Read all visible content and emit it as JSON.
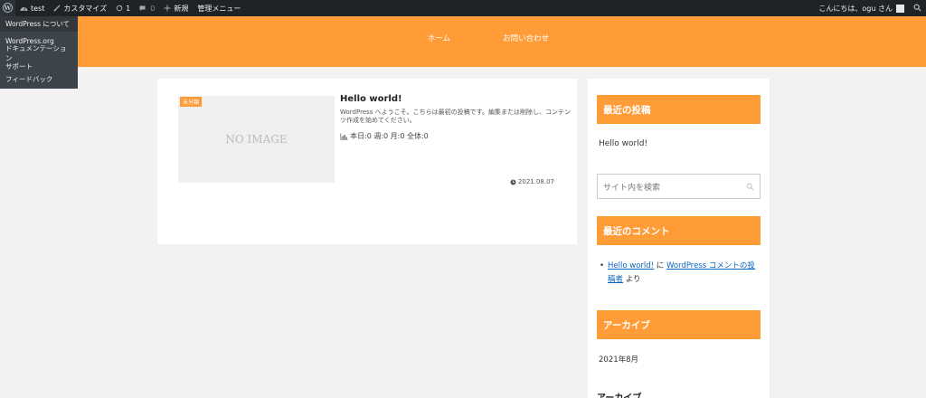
{
  "adminbar": {
    "site_name": "test",
    "customize": "カスタマイズ",
    "updates_count": "1",
    "comments_count": "0",
    "new_label": "新規",
    "menu_label": "管理メニュー",
    "greeting": "こんにちは、ogu さん"
  },
  "wp_menu": {
    "about": "WordPress について",
    "items": [
      "WordPress.org",
      "ドキュメンテーション",
      "サポート",
      "フィードバック"
    ]
  },
  "nav": {
    "items": [
      "ホーム",
      "お問い合わせ"
    ]
  },
  "post": {
    "category": "未分類",
    "thumbnail_text": "NO IMAGE",
    "title": "Hello world!",
    "excerpt": "WordPress へようこそ。こちらは最初の投稿です。編集または削除し、コンテンツ作成を始めてください。",
    "stats": "本日:0 週:0 月:0 全体:0",
    "date": "2021.08.07"
  },
  "sidebar": {
    "recent_posts_title": "最近の投稿",
    "recent_post": "Hello world!",
    "search_placeholder": "サイト内を検索",
    "recent_comments_title": "最近のコメント",
    "comment": {
      "post_link": "Hello world!",
      "connector": "に",
      "author_link": "WordPress コメントの投稿者",
      "suffix": "より"
    },
    "archive_title": "アーカイブ",
    "archive_item": "2021年8月",
    "archive_title_2": "アーカイブ"
  },
  "colors": {
    "accent": "#ff9c38",
    "adminbar": "#1d2327",
    "link": "#0b64c0"
  }
}
